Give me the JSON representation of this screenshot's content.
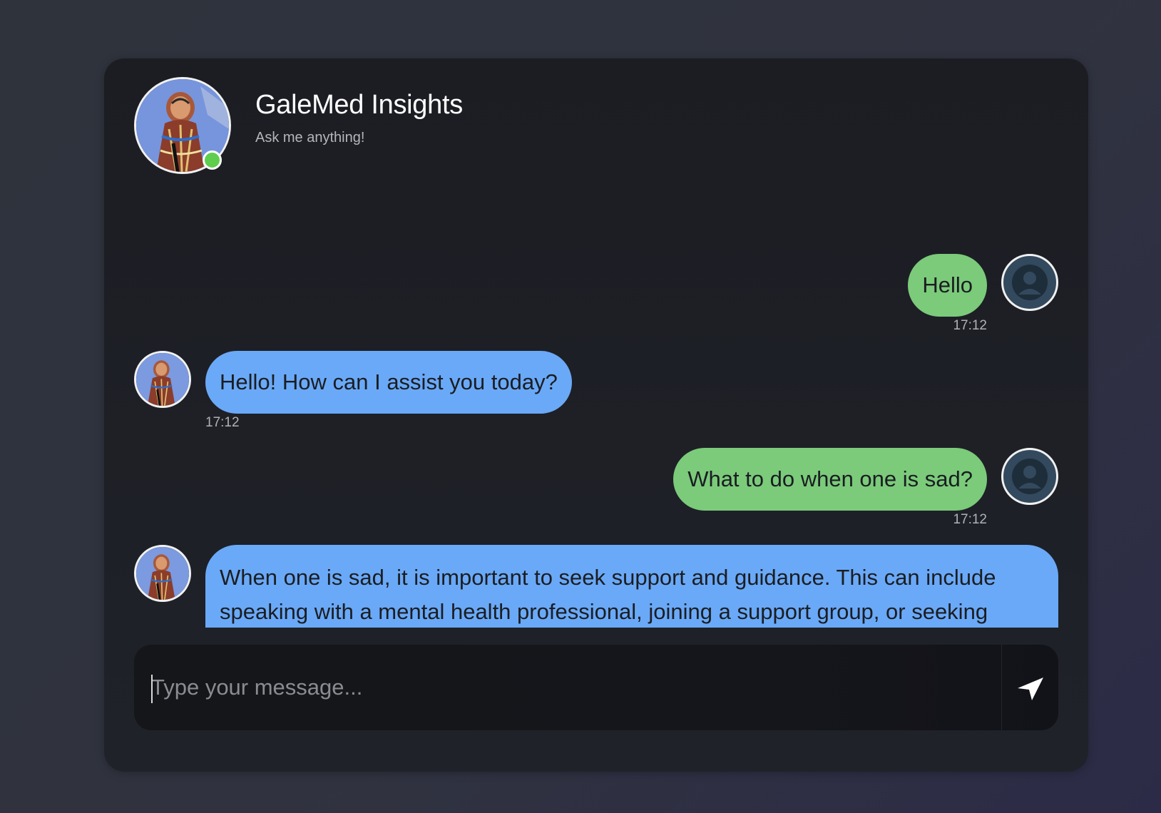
{
  "header": {
    "bot_name": "GaleMed Insights",
    "subtitle": "Ask me anything!",
    "status": "online"
  },
  "messages": [
    {
      "sender": "user",
      "text": "Hello",
      "time": "17:12"
    },
    {
      "sender": "bot",
      "text": "Hello! How can I assist you today?",
      "time": "17:12"
    },
    {
      "sender": "user",
      "text": "What to do when one is sad?",
      "time": "17:12"
    },
    {
      "sender": "bot",
      "text": "When one is sad, it is important to seek support and guidance. This can include speaking with a mental health professional, joining a support group, or seeking spiritual guidance through prayer and meditation. Additionally, taking care of oneself physically and emotionally can help improve mood. If the sadness is"
    }
  ],
  "input": {
    "placeholder": "Type your message...",
    "value": ""
  },
  "icons": {
    "send": "send-icon",
    "user_avatar": "user-icon",
    "online_indicator": "status-dot"
  },
  "colors": {
    "user_bubble": "#7bcb7a",
    "bot_bubble": "#6aa9f7",
    "online": "#5fce4e",
    "card_bg": "#1c1d23"
  }
}
